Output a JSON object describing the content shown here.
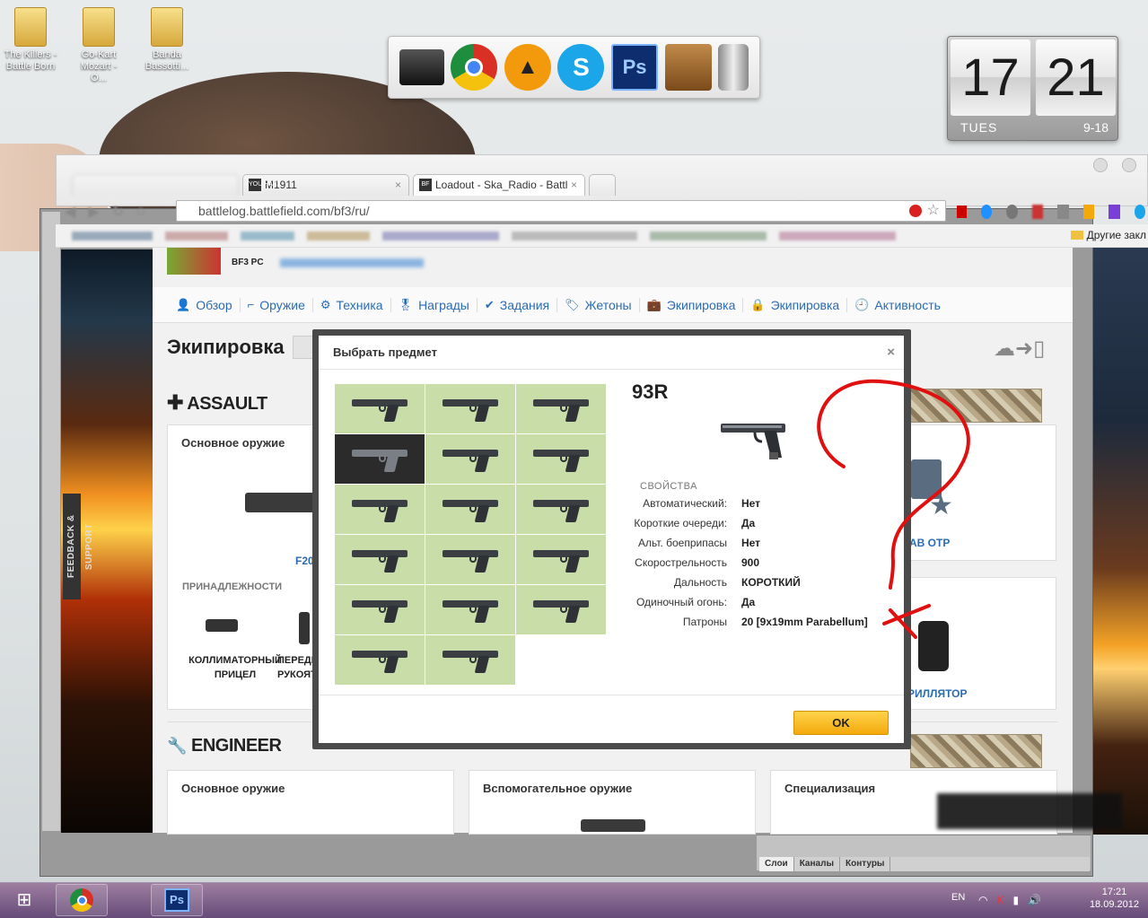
{
  "desktop": {
    "icons": [
      {
        "label": "The Killers - Battle Born"
      },
      {
        "label": "Go-Kart Mozart - O..."
      },
      {
        "label": "Banda Bassotti..."
      }
    ],
    "dock_apps": [
      {
        "name": "monitor-icon"
      },
      {
        "name": "chrome-icon"
      },
      {
        "name": "aimp-icon"
      },
      {
        "name": "skype-icon"
      },
      {
        "name": "photoshop-icon",
        "label": "Ps"
      },
      {
        "name": "folder-icon"
      },
      {
        "name": "trash-icon"
      }
    ],
    "clock": {
      "hour": "17",
      "minute": "21",
      "day": "TUES",
      "date": "9-18"
    }
  },
  "browser": {
    "tabs": [
      {
        "label": "M1911",
        "favicon": "YOU HAXX"
      },
      {
        "label": "Loadout - Ska_Radio - Battl",
        "favicon": "BF"
      }
    ],
    "url": "battlelog.battlefield.com/bf3/ru/",
    "bookmarks_other": "Другие закл"
  },
  "page": {
    "platform": "PC",
    "nav": [
      {
        "label": "Обзор",
        "icon": "person-icon"
      },
      {
        "label": "Оружие",
        "icon": "gun-icon"
      },
      {
        "label": "Техника",
        "icon": "gear-icon"
      },
      {
        "label": "Награды",
        "icon": "medal-icon"
      },
      {
        "label": "Задания",
        "icon": "check-icon"
      },
      {
        "label": "Жетоны",
        "icon": "tag-icon"
      },
      {
        "label": "Экипировка",
        "icon": "briefcase-icon"
      },
      {
        "label": "Экипировка",
        "icon": "lock-icon"
      },
      {
        "label": "Активность",
        "icon": "clock-icon"
      }
    ],
    "title": "Экипировка",
    "feedback": "FEEDBACK & SUPPORT",
    "assault": {
      "heading": "ASSAULT",
      "primary_label": "Основное оружие",
      "weapon_partial": "F20",
      "accessories_label": "ПРИНАДЛЕЖНОСТИ",
      "acc1": "КОЛЛИМАТОРНЫЙ ПРИЦЕЛ",
      "acc2": "ПЕРЕДН РУКОЯТ",
      "right_label1": "АВ ОТР",
      "right_label2": "РИЛЛЯТОР"
    },
    "engineer": {
      "heading": "ENGINEER",
      "primary_label": "Основное оружие",
      "secondary_label": "Вспомогательное оружие",
      "spec_label": "Специализация"
    }
  },
  "modal": {
    "title": "Выбрать предмет",
    "close": "×",
    "selected_index": 3,
    "grid_count": 17,
    "weapon_name": "93R",
    "props_heading": "СВОЙСТВА",
    "props": [
      {
        "k": "Автоматический:",
        "v": "Нет"
      },
      {
        "k": "Короткие очереди:",
        "v": "Да"
      },
      {
        "k": "Альт. боеприпасы",
        "v": "Нет"
      },
      {
        "k": "Скорострельность",
        "v": "900"
      },
      {
        "k": "Дальность",
        "v": "КОРОТКИЙ"
      },
      {
        "k": "Одиночный огонь:",
        "v": "Да"
      },
      {
        "k": "Патроны",
        "v": "20 [9x19mm Parabellum]"
      }
    ],
    "ok": "OK"
  },
  "photoshop": {
    "tabs": [
      "Слои",
      "Каналы",
      "Контуры"
    ]
  },
  "taskbar": {
    "time": "17:21",
    "date": "18.09.2012",
    "lang": "EN"
  },
  "colors": {
    "accent_blue": "#2a6cb3",
    "ok_yellow": "#f3a90c",
    "grid_green": "#c9dda8",
    "annotation_red": "#e01010"
  }
}
